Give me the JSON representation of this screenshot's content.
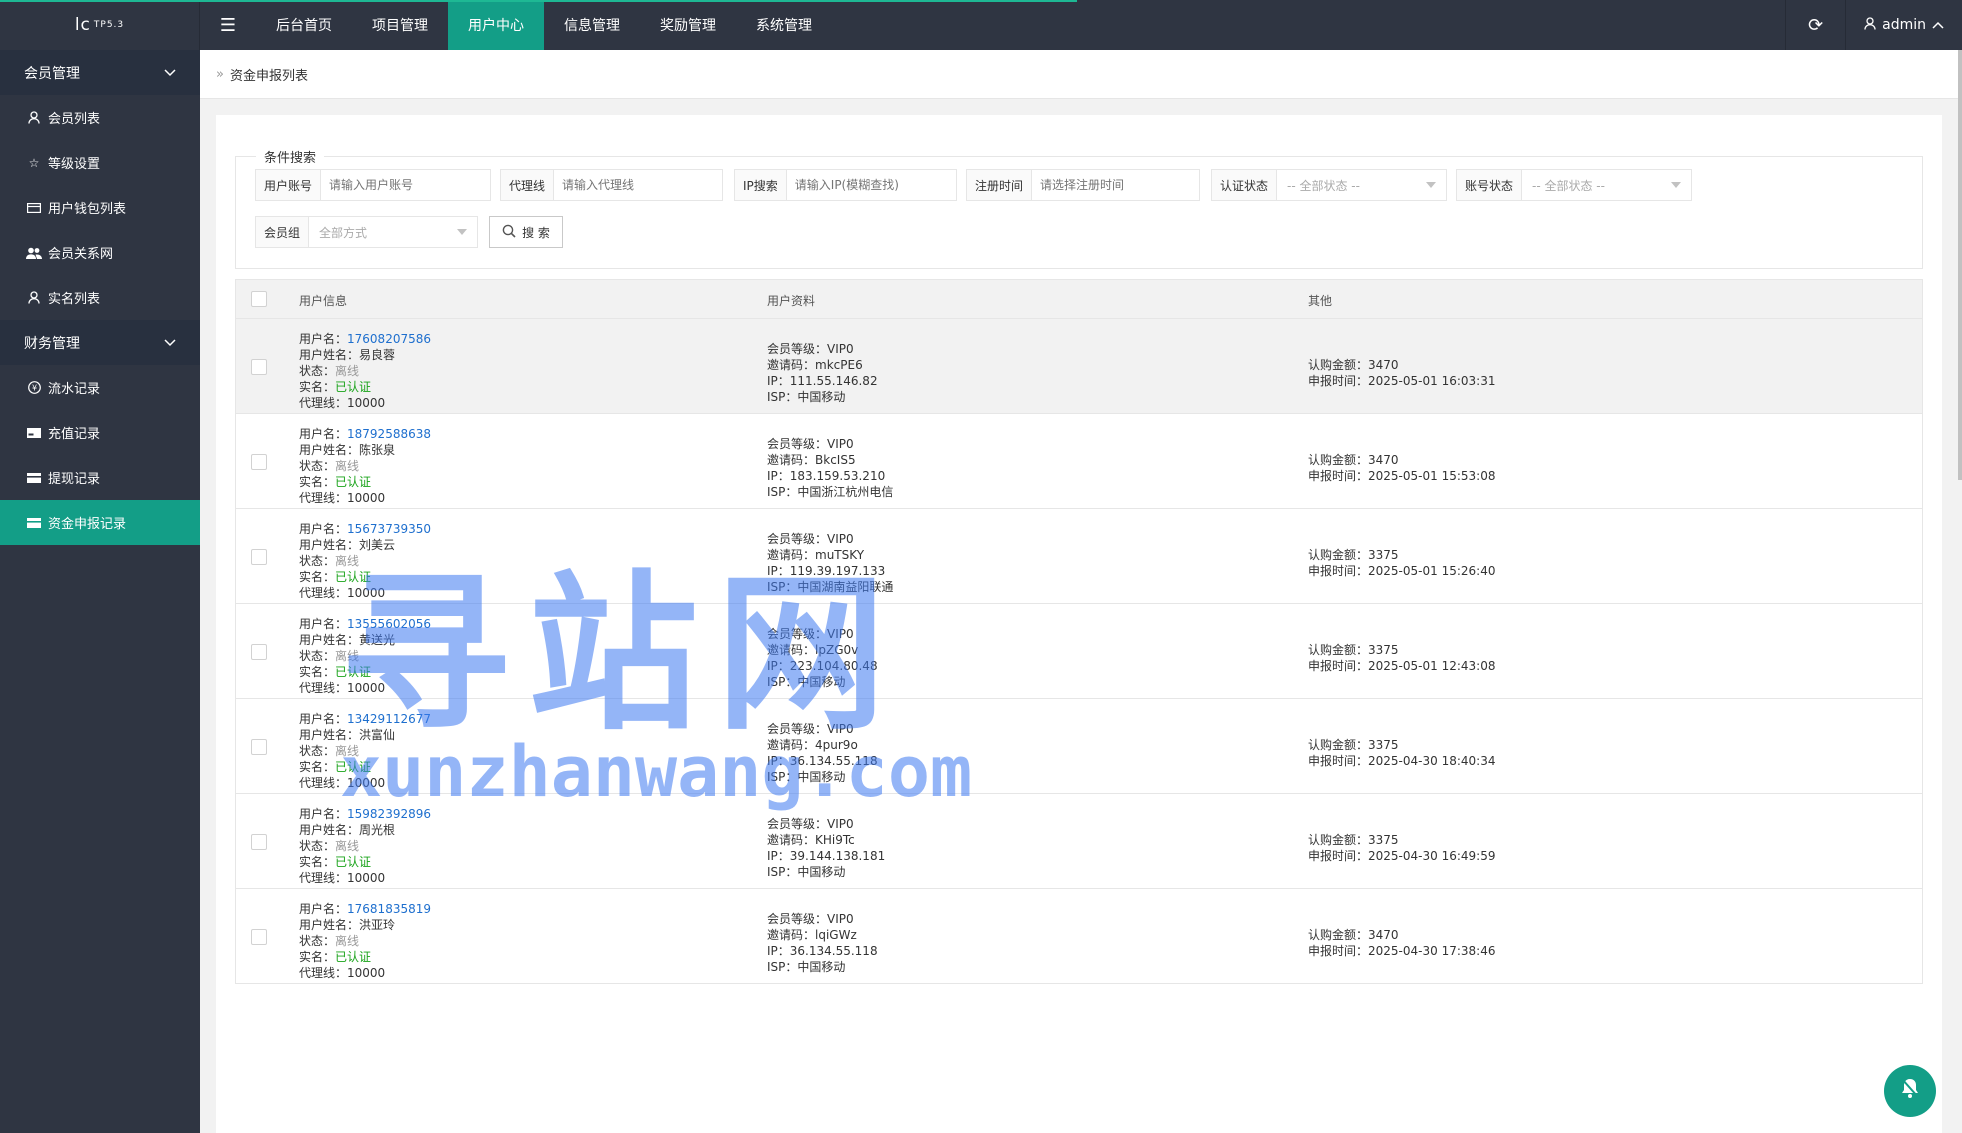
{
  "brand": {
    "logo": "lc",
    "version": "TP5.3"
  },
  "topnav": [
    "后台首页",
    "项目管理",
    "用户中心",
    "信息管理",
    "奖励管理",
    "系统管理"
  ],
  "active_topnav": "用户中心",
  "user": "admin",
  "sidebar": {
    "groups": [
      {
        "label": "会员管理",
        "items": [
          {
            "label": "会员列表",
            "icon": "user-icon"
          },
          {
            "label": "等级设置",
            "icon": "star-icon"
          },
          {
            "label": "用户钱包列表",
            "icon": "card-icon"
          },
          {
            "label": "会员关系网",
            "icon": "users-icon"
          },
          {
            "label": "实名列表",
            "icon": "user-icon"
          }
        ]
      },
      {
        "label": "财务管理",
        "items": [
          {
            "label": "流水记录",
            "icon": "coin-icon"
          },
          {
            "label": "充值记录",
            "icon": "recharge-icon"
          },
          {
            "label": "提现记录",
            "icon": "withdraw-icon"
          },
          {
            "label": "资金申报记录",
            "icon": "card-icon"
          }
        ]
      }
    ],
    "active_item": "资金申报记录"
  },
  "breadcrumb": "资金申报列表",
  "search": {
    "legend": "条件搜索",
    "fields": {
      "account": {
        "label": "用户账号",
        "placeholder": "请输入用户账号"
      },
      "agent": {
        "label": "代理线",
        "placeholder": "请输入代理线"
      },
      "ip": {
        "label": "IP搜索",
        "placeholder": "请输入IP(模糊查找)"
      },
      "regtime": {
        "label": "注册时间",
        "placeholder": "请选择注册时间"
      },
      "auth": {
        "label": "认证状态",
        "value": "-- 全部状态 --"
      },
      "acct_status": {
        "label": "账号状态",
        "value": "-- 全部状态 --"
      },
      "group": {
        "label": "会员组",
        "value": "全部方式"
      }
    },
    "button": "搜 索"
  },
  "table": {
    "headers": [
      "用户信息",
      "用户资料",
      "其他"
    ],
    "labels": {
      "username": "用户名：",
      "realname": "用户姓名：",
      "status": "状态：",
      "verified": "实名：",
      "agent": "代理线：",
      "level": "会员等级：",
      "invite": "邀请码：",
      "ip": "IP：",
      "isp": "ISP：",
      "amount": "认购金额：",
      "time": "申报时间："
    },
    "rows": [
      {
        "username": "17608207586",
        "realname": "易良蓉",
        "status": "离线",
        "verified": "已认证",
        "agent": "10000",
        "level": "VIP0",
        "invite": "mkcPE6",
        "ip": "111.55.146.82",
        "isp": "中国移动",
        "amount": "3470",
        "time": "2025-05-01 16:03:31"
      },
      {
        "username": "18792588638",
        "realname": "陈张泉",
        "status": "离线",
        "verified": "已认证",
        "agent": "10000",
        "level": "VIP0",
        "invite": "BkcIS5",
        "ip": "183.159.53.210",
        "isp": "中国浙江杭州电信",
        "amount": "3470",
        "time": "2025-05-01 15:53:08"
      },
      {
        "username": "15673739350",
        "realname": "刘美云",
        "status": "离线",
        "verified": "已认证",
        "agent": "10000",
        "level": "VIP0",
        "invite": "muTSKY",
        "ip": "119.39.197.133",
        "isp": "中国湖南益阳联通",
        "amount": "3375",
        "time": "2025-05-01 15:26:40"
      },
      {
        "username": "13555602056",
        "realname": "黄送光",
        "status": "离线",
        "verified": "已认证",
        "agent": "10000",
        "level": "VIP0",
        "invite": "lpZG0v",
        "ip": "223.104.80.48",
        "isp": "中国移动",
        "amount": "3375",
        "time": "2025-05-01 12:43:08"
      },
      {
        "username": "13429112677",
        "realname": "洪富仙",
        "status": "离线",
        "verified": "已认证",
        "agent": "10000",
        "level": "VIP0",
        "invite": "4pur9o",
        "ip": "36.134.55.118",
        "isp": "中国移动",
        "amount": "3375",
        "time": "2025-04-30 18:40:34"
      },
      {
        "username": "15982392896",
        "realname": "周光根",
        "status": "离线",
        "verified": "已认证",
        "agent": "10000",
        "level": "VIP0",
        "invite": "KHi9Tc",
        "ip": "39.144.138.181",
        "isp": "中国移动",
        "amount": "3375",
        "time": "2025-04-30 16:49:59"
      },
      {
        "username": "17681835819",
        "realname": "洪亚玲",
        "status": "离线",
        "verified": "已认证",
        "agent": "10000",
        "level": "VIP0",
        "invite": "lqiGWz",
        "ip": "36.134.55.118",
        "isp": "中国移动",
        "amount": "3470",
        "time": "2025-04-30 17:38:46"
      }
    ]
  },
  "watermark": {
    "title": "寻站网",
    "domain": "xunzhanwang.com"
  },
  "colors": {
    "topbar": "#2f3542",
    "accent": "#139e87",
    "link": "#1e6fce",
    "verified": "#1aa31a"
  }
}
